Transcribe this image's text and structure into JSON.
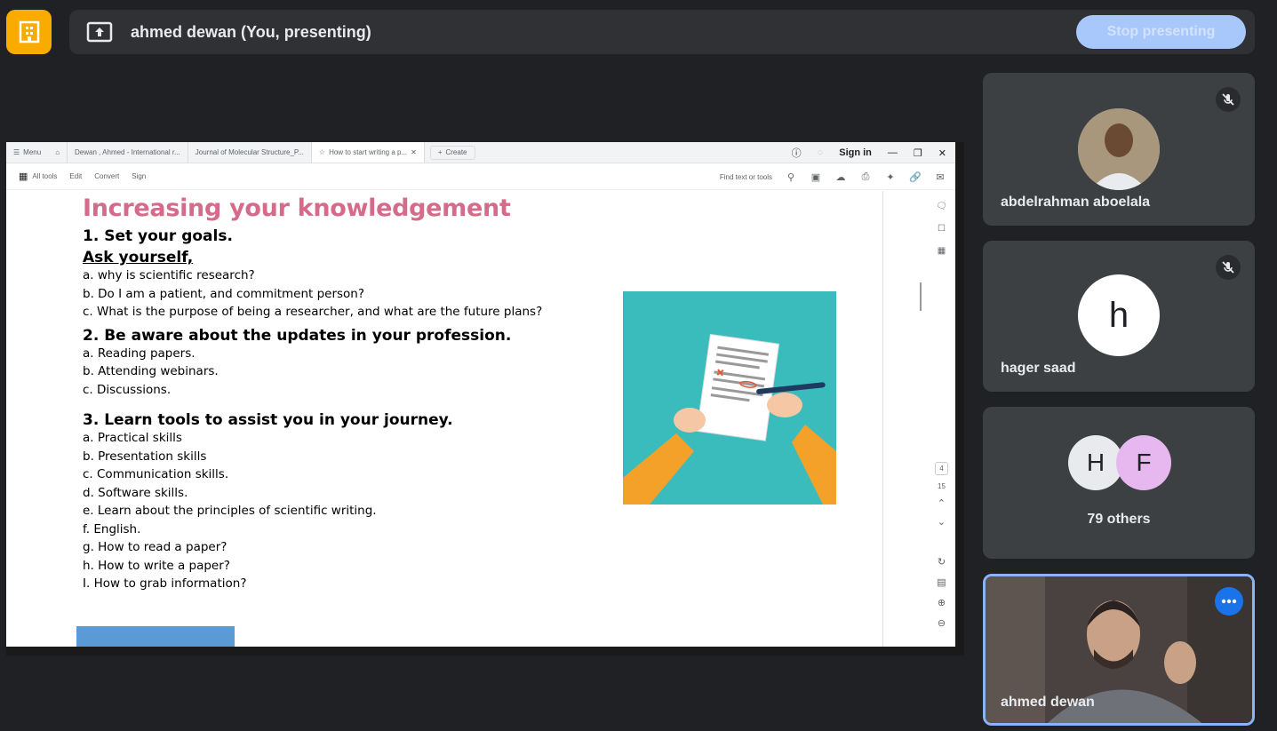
{
  "header": {
    "presenter_title": "ahmed dewan (You, presenting)",
    "stop_label": "Stop presenting"
  },
  "shared_screen": {
    "tabs": [
      {
        "label": "Menu"
      },
      {
        "label": "Dewan , Ahmed - International r..."
      },
      {
        "label": "Journal of Molecular Structure_P..."
      },
      {
        "label": "How to start writing a p..."
      },
      {
        "label": "Create"
      }
    ],
    "sign_in": "Sign in",
    "toolbar": {
      "all_tools": "All tools",
      "edit": "Edit",
      "convert": "Convert",
      "sign": "Sign",
      "find": "Find text or tools"
    },
    "page_indicator": {
      "current": "4",
      "total": "15"
    },
    "document": {
      "title": "Increasing your knowledgement",
      "section1": "1.   Set your goals.",
      "ask": "Ask yourself,",
      "list1": [
        "a.    why is scientific research?",
        "b.   Do I am a patient, and commitment person?",
        "c.    What is the purpose of being a researcher, and what are the future plans?"
      ],
      "section2": "2. Be aware about the updates in your profession.",
      "list2": [
        "a. Reading papers.",
        "b. Attending webinars.",
        "c. Discussions."
      ],
      "section3": "3. Learn tools to assist you in your journey.",
      "list3": [
        "a. Practical skills",
        "b. Presentation skills",
        "c. Communication skills.",
        "d. Software skills.",
        "e. Learn about the principles of scientific writing.",
        "f. English.",
        "g. How to read a paper?",
        "h. How to write a paper?",
        "I. How to grab information?"
      ]
    }
  },
  "participants": [
    {
      "name": "abdelrahman aboelala",
      "muted": true
    },
    {
      "name": "hager saad",
      "initial": "h",
      "muted": true
    },
    {
      "name": "79 others",
      "initials": [
        "H",
        "F"
      ]
    },
    {
      "name": "ahmed dewan"
    }
  ],
  "colors": {
    "background": "#202124",
    "tile": "#3c4043",
    "accent": "#f9ab00",
    "title_pink": "#d56a8a",
    "stop_button": "#a8c7fa"
  }
}
